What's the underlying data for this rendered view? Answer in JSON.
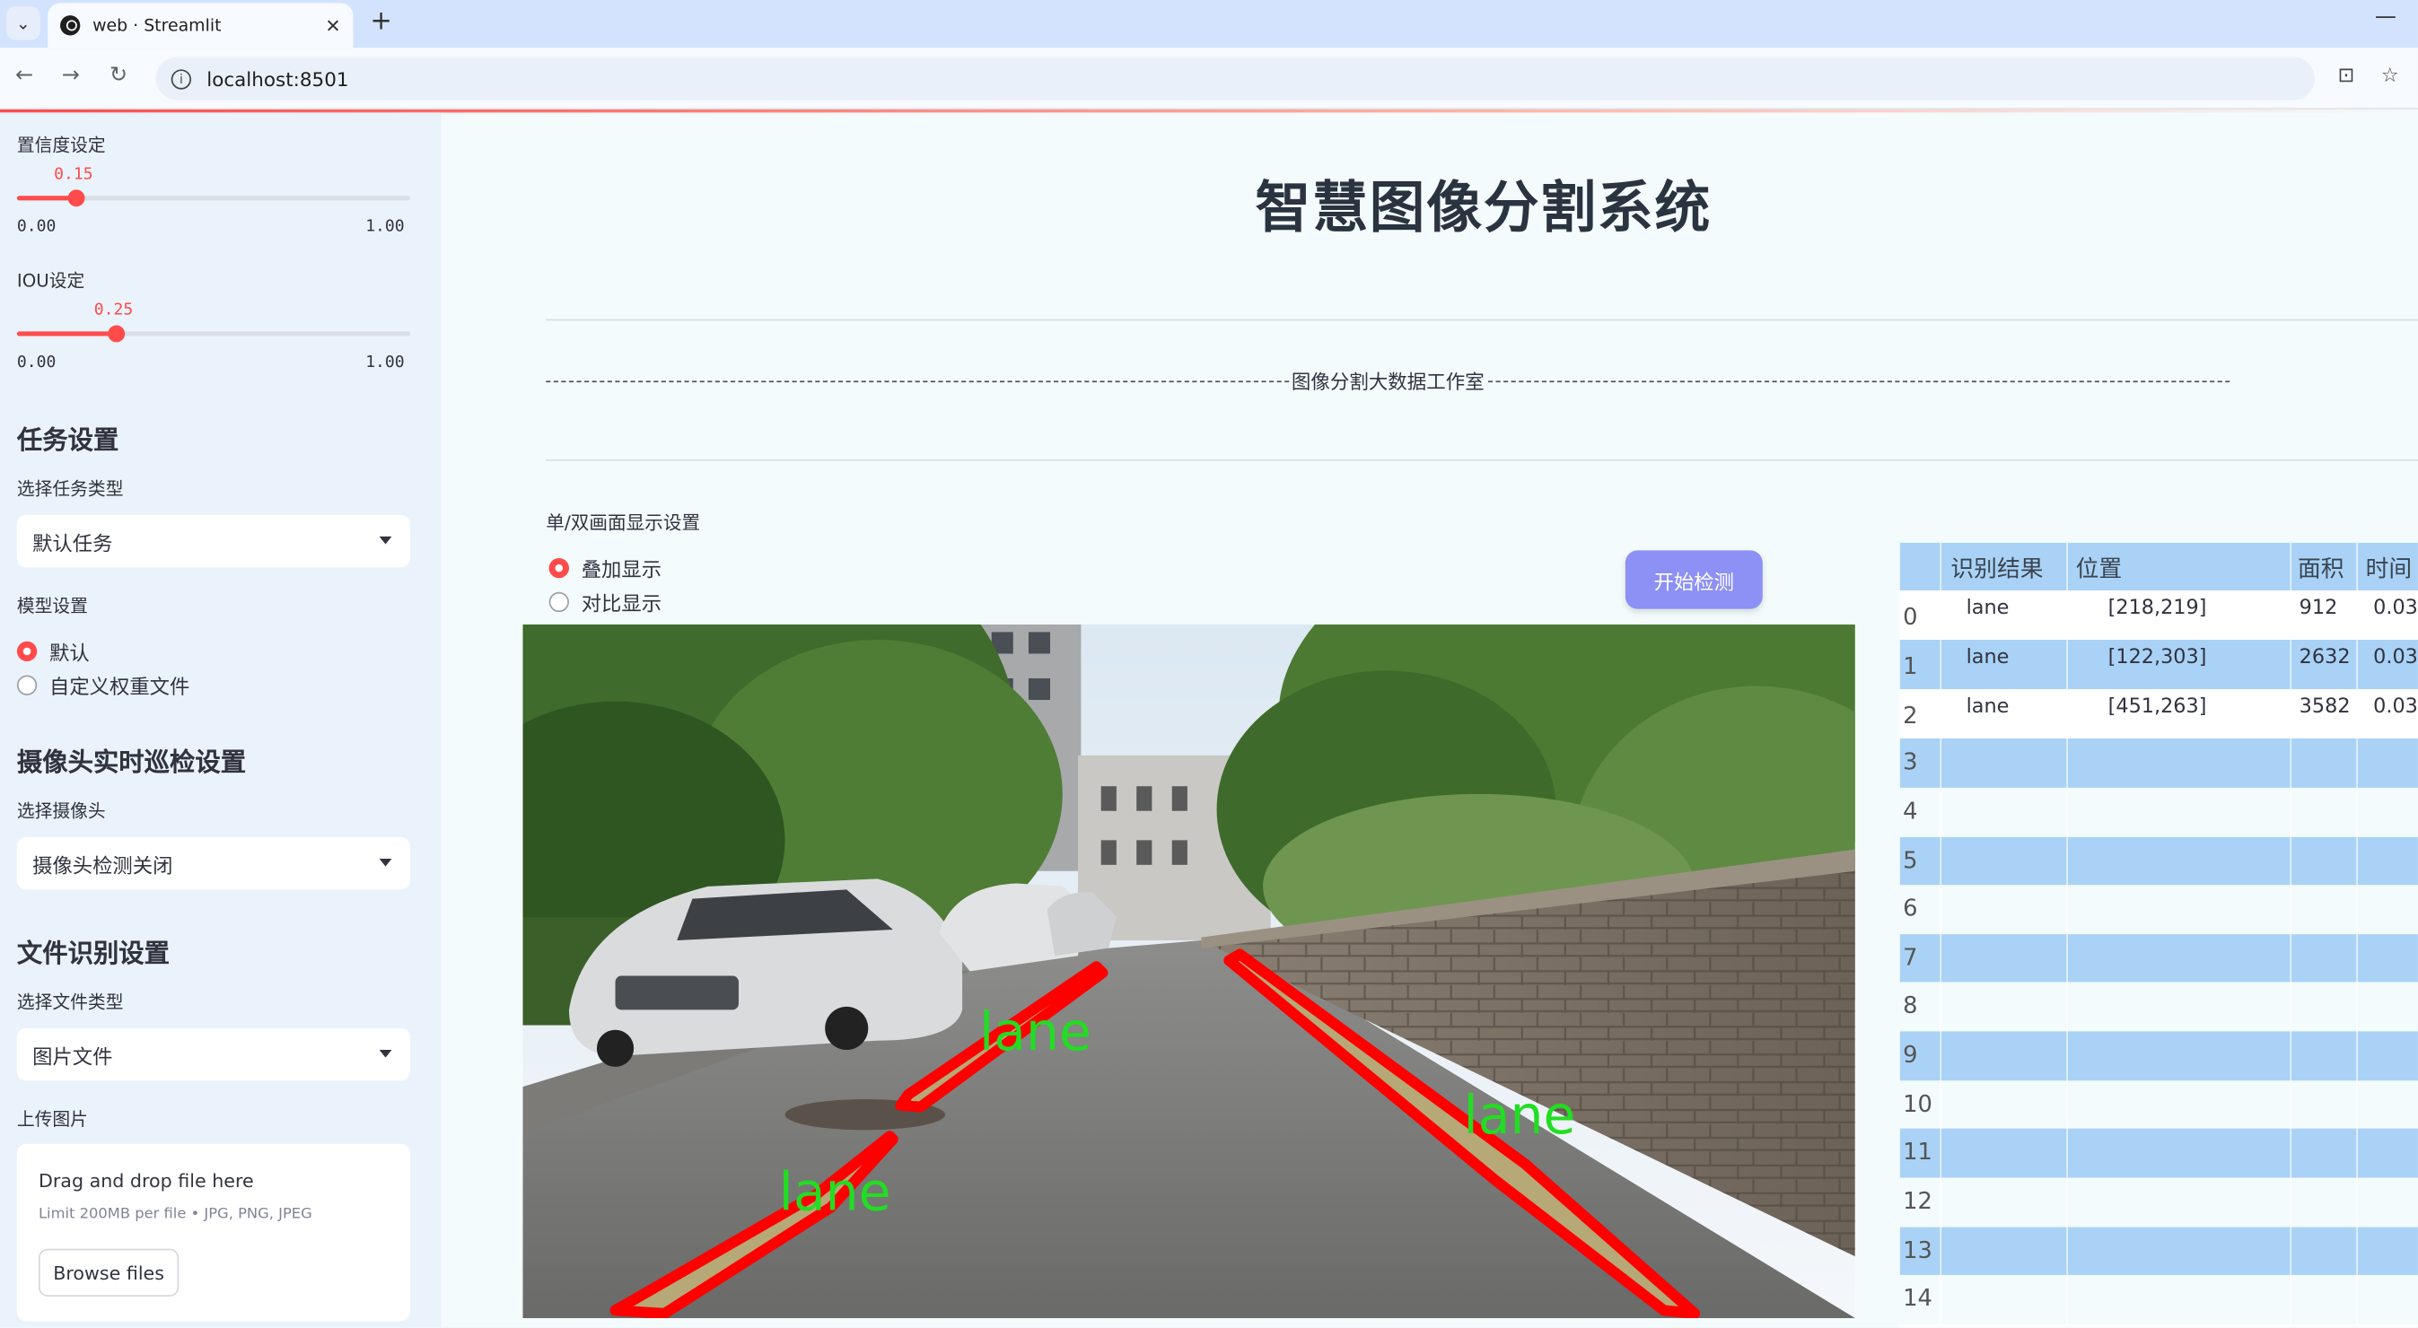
{
  "browser": {
    "tab_title": "web · Streamlit",
    "url": "localhost:8501"
  },
  "sidebar": {
    "confidence": {
      "label": "置信度设定",
      "value": "0.15",
      "min": "0.00",
      "max": "1.00",
      "fraction": 0.15
    },
    "iou": {
      "label": "IOU设定",
      "value": "0.25",
      "min": "0.00",
      "max": "1.00",
      "fraction": 0.25
    },
    "task_heading": "任务设置",
    "task_type_label": "选择任务类型",
    "task_type_value": "默认任务",
    "model_label": "模型设置",
    "model_options": [
      "默认",
      "自定义权重文件"
    ],
    "model_selected": "默认",
    "camera_heading": "摄像头实时巡检设置",
    "camera_label": "选择摄像头",
    "camera_value": "摄像头检测关闭",
    "file_heading": "文件识别设置",
    "file_type_label": "选择文件类型",
    "file_type_value": "图片文件",
    "upload_label": "上传图片",
    "upload": {
      "drag_text": "Drag and drop file here",
      "limit_text": "Limit 200MB per file • JPG, PNG, JPEG",
      "browse_label": "Browse files"
    }
  },
  "main": {
    "title": "智慧图像分割系统",
    "subtitle": "图像分割大数据工作室",
    "display_label": "单/双画面显示设置",
    "display_options": [
      "叠加显示",
      "对比显示"
    ],
    "display_selected": "叠加显示",
    "start_button": "开始检测",
    "detection_label": "lane"
  },
  "table": {
    "columns": [
      "识别结果",
      "位置",
      "面积",
      "时间"
    ],
    "rows": [
      {
        "index": "0",
        "result": "lane",
        "position": "[218,219]",
        "area": "912",
        "time": "0.03"
      },
      {
        "index": "1",
        "result": "lane",
        "position": "[122,303]",
        "area": "2632",
        "time": "0.03"
      },
      {
        "index": "2",
        "result": "lane",
        "position": "[451,263]",
        "area": "3582",
        "time": "0.03"
      }
    ],
    "empty_indices": [
      "3",
      "4",
      "5",
      "6",
      "7",
      "8",
      "9",
      "10",
      "11",
      "12",
      "13",
      "14"
    ]
  },
  "colors": {
    "accent": "#ff4b4b",
    "button": "#8d90f5",
    "table_header": "#a9d2f6",
    "mask_outline": "#ff0000",
    "label_text": "#22dd22"
  }
}
